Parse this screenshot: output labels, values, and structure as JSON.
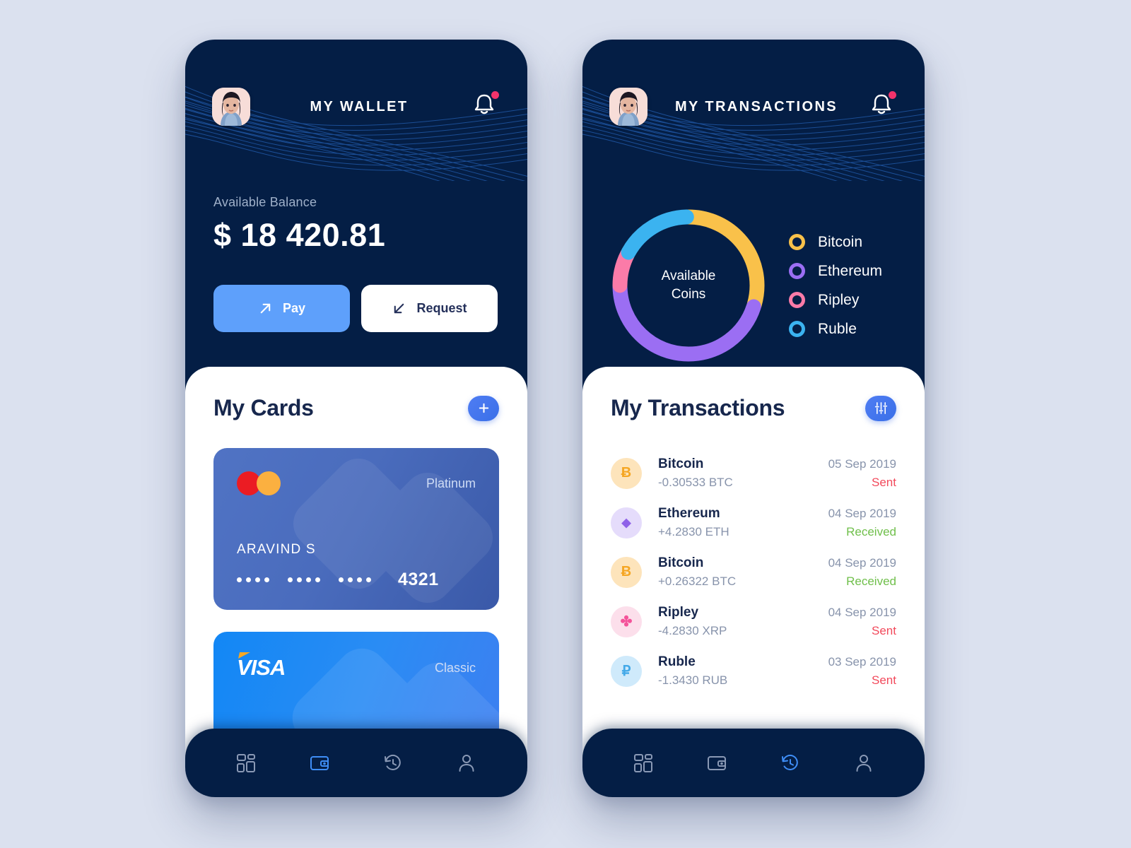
{
  "colors": {
    "page_bg": "#dbe1ef",
    "navy": "#041e45",
    "accent_blue": "#5ea0fb",
    "bitcoin": "#f9c14a",
    "ethereum": "#9b6ef3",
    "ripley": "#fb7ba8",
    "ruble": "#3bb3f0",
    "sent": "#f2495b",
    "received": "#6fbf4a",
    "notification_dot": "#f2336b"
  },
  "wallet_screen": {
    "header": {
      "title": "MY WALLET",
      "avatar_name": "user-avatar",
      "bell_icon": "bell-icon",
      "has_notification": true
    },
    "balance": {
      "label": "Available Balance",
      "amount": "$ 18 420.81"
    },
    "actions": [
      {
        "label": "Pay",
        "icon": "arrow-up-right-icon",
        "style": "primary"
      },
      {
        "label": "Request",
        "icon": "arrow-down-left-icon",
        "style": "secondary"
      }
    ],
    "cards_section": {
      "title": "My Cards",
      "add_icon": "plus-icon",
      "cards": [
        {
          "brand": "mastercard",
          "brand_label": "",
          "tier": "Platinum",
          "holder": "ARAVIND S",
          "masked_groups": [
            "....",
            "....",
            "...."
          ],
          "last4": "4321"
        },
        {
          "brand": "visa",
          "brand_label": "VISA",
          "tier": "Classic",
          "holder": "",
          "masked_groups": [],
          "last4": ""
        }
      ]
    },
    "nav": [
      {
        "icon": "dashboard-icon",
        "active": false
      },
      {
        "icon": "wallet-icon",
        "active": true
      },
      {
        "icon": "history-icon",
        "active": false
      },
      {
        "icon": "profile-icon",
        "active": false
      }
    ]
  },
  "transactions_screen": {
    "header": {
      "title": "MY TRANSACTIONS",
      "avatar_name": "user-avatar",
      "bell_icon": "bell-icon",
      "has_notification": true
    },
    "donut_center_line1": "Available",
    "donut_center_line2": "Coins",
    "list_section": {
      "title": "My Transactions",
      "filter_icon": "sliders-icon"
    },
    "transactions": [
      {
        "coin": "Bitcoin",
        "symbol": "btc-icon",
        "amount": "-0.30533 BTC",
        "date": "05 Sep 2019",
        "status": "Sent",
        "status_type": "sent"
      },
      {
        "coin": "Ethereum",
        "symbol": "eth-icon",
        "amount": "+4.2830 ETH",
        "date": "04 Sep 2019",
        "status": "Received",
        "status_type": "received"
      },
      {
        "coin": "Bitcoin",
        "symbol": "btc-icon",
        "amount": "+0.26322 BTC",
        "date": "04 Sep 2019",
        "status": "Received",
        "status_type": "received"
      },
      {
        "coin": "Ripley",
        "symbol": "xrp-icon",
        "amount": "-4.2830 XRP",
        "date": "04 Sep 2019",
        "status": "Sent",
        "status_type": "sent"
      },
      {
        "coin": "Ruble",
        "symbol": "rub-icon",
        "amount": "-1.3430 RUB",
        "date": "03 Sep 2019",
        "status": "Sent",
        "status_type": "sent"
      }
    ],
    "nav": [
      {
        "icon": "dashboard-icon",
        "active": false
      },
      {
        "icon": "wallet-icon",
        "active": false
      },
      {
        "icon": "history-icon",
        "active": true
      },
      {
        "icon": "profile-icon",
        "active": false
      }
    ]
  },
  "chart_data": {
    "type": "pie",
    "title": "Available Coins",
    "categories": [
      "Bitcoin",
      "Ethereum",
      "Ripley",
      "Ruble"
    ],
    "values": [
      30,
      45,
      8,
      17
    ],
    "unit": "%",
    "colors": [
      "#f9c14a",
      "#9b6ef3",
      "#fb7ba8",
      "#3bb3f0"
    ],
    "legend": [
      "Bitcoin",
      "Ethereum",
      "Ripley",
      "Ruble"
    ],
    "legend_position": "right",
    "donut": true,
    "center_label": "Available Coins"
  }
}
